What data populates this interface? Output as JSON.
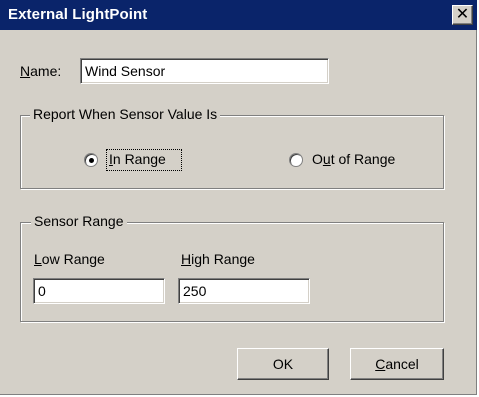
{
  "window": {
    "title": "External LightPoint",
    "close_glyph": "✕"
  },
  "name_field": {
    "label_mnemonic": "N",
    "label_rest": "ame:",
    "value": "Wind Sensor"
  },
  "report_group": {
    "title": "Report When Sensor Value Is",
    "in_range": {
      "mnemonic": "I",
      "rest": "n Range",
      "selected": true
    },
    "out_of_range": {
      "before": "O",
      "mnemonic": "u",
      "rest": "t of Range",
      "selected": false
    }
  },
  "range_group": {
    "title": "Sensor Range",
    "low": {
      "label_mnemonic": "L",
      "label_rest": "ow Range",
      "value": "0"
    },
    "high": {
      "label_mnemonic": "H",
      "label_rest": "igh Range",
      "value": "250"
    }
  },
  "buttons": {
    "ok": "OK",
    "cancel_mnemonic": "C",
    "cancel_rest": "ancel"
  },
  "colors": {
    "titlebar": "#0a246a",
    "dialog_face": "#d4d0c8"
  },
  "icons": {
    "close": "close-icon",
    "radio_selected": "radio-dot-icon"
  }
}
